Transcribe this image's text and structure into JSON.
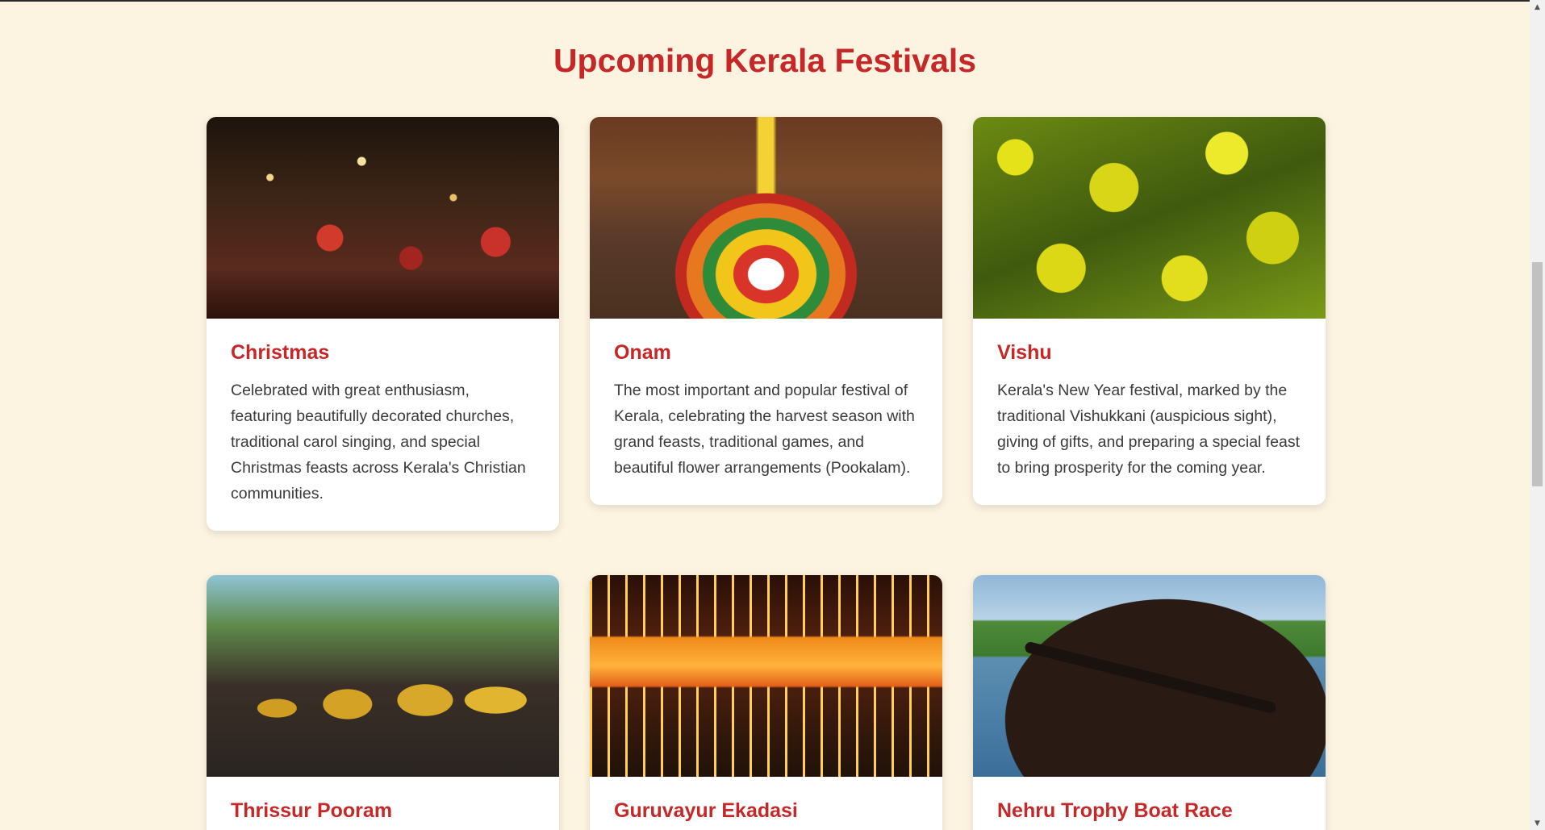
{
  "section": {
    "title": "Upcoming Kerala Festivals"
  },
  "festivals": [
    {
      "image": "christmas-photo",
      "title": "Christmas",
      "description": "Celebrated with great enthusiasm, featuring beautifully decorated churches, traditional carol singing, and special Christmas feasts across Kerala's Christian communities."
    },
    {
      "image": "onam-photo",
      "title": "Onam",
      "description": "The most important and popular festival of Kerala, celebrating the harvest season with grand feasts, traditional games, and beautiful flower arrangements (Pookalam)."
    },
    {
      "image": "vishu-photo",
      "title": "Vishu",
      "description": "Kerala's New Year festival, marked by the traditional Vishukkani (auspicious sight), giving of gifts, and preparing a special feast to bring prosperity for the coming year."
    },
    {
      "image": "thrissur-pooram-photo",
      "title": "Thrissur Pooram",
      "description": ""
    },
    {
      "image": "guruvayur-ekadasi-photo",
      "title": "Guruvayur Ekadasi",
      "description": ""
    },
    {
      "image": "boat-race-photo",
      "title": "Nehru Trophy Boat Race",
      "description": ""
    }
  ],
  "colors": {
    "page_background": "#fdf3e1",
    "accent": "#c62828",
    "card_background": "#ffffff",
    "body_text": "#3a3a3a"
  },
  "scrollbar": {
    "up_icon": "▲",
    "down_icon": "▼"
  }
}
